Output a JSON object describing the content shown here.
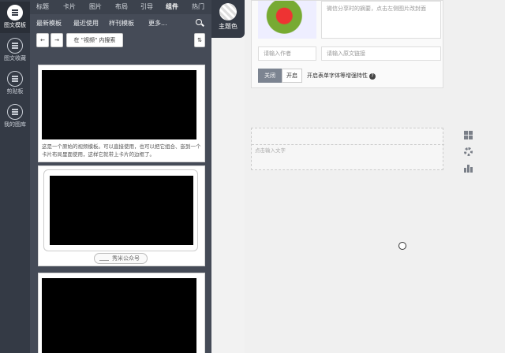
{
  "rail": {
    "items": [
      {
        "label": "图文模板",
        "icon": "template-icon"
      },
      {
        "label": "图文收藏",
        "icon": "collection-icon"
      },
      {
        "label": "剪贴板",
        "icon": "clipboard-icon"
      },
      {
        "label": "我的图库",
        "icon": "gallery-icon"
      }
    ]
  },
  "tabs": [
    "标题",
    "卡片",
    "图片",
    "布局",
    "引导",
    "组件",
    "热门"
  ],
  "active_tab": "组件",
  "subtabs": [
    "最新模板",
    "最近使用",
    "样刊模板",
    "更多..."
  ],
  "toolbar": {
    "prev": "←",
    "next": "→",
    "filter": "在 \"视频\" 内搜索"
  },
  "cards": {
    "card1_text": "这是一个原始的视频模板。可以直接使用，也可以把它组合、嵌到一个卡片布局里面使用，这样它就带上卡片的边框了。",
    "card2_badge": "秀米公众号"
  },
  "theme": {
    "label": "主题色"
  },
  "editor": {
    "summary_placeholder": "微信分享时的摘要，点击左侧图片改封面",
    "author_placeholder": "请输入作者",
    "link_placeholder": "请输入原文链接",
    "toggle_off": "关闭",
    "toggle_on": "开启",
    "option_label": "开启表单字体等增强特性",
    "help": "?",
    "block_placeholder": "点击输入文字"
  }
}
